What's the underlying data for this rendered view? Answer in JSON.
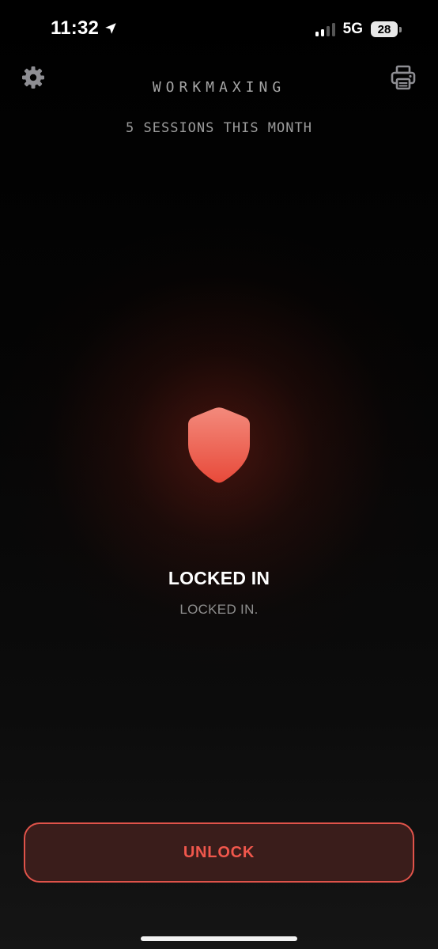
{
  "status_bar": {
    "time": "11:32",
    "network": "5G",
    "battery": "28",
    "icons": {
      "location": "location-arrow-icon",
      "signal": "cellular-signal-icon",
      "battery": "battery-icon"
    }
  },
  "header": {
    "title": "WORKMAXING",
    "sessions_text": "5 SESSIONS THIS MONTH",
    "settings_icon": "gear-icon",
    "print_icon": "printer-icon"
  },
  "main": {
    "shield_icon": "shield-icon",
    "status_title": "LOCKED IN",
    "status_subtitle": "LOCKED IN."
  },
  "actions": {
    "unlock_label": "UNLOCK"
  },
  "colors": {
    "accent": "#f0574c",
    "button_background": "#3a1d1b",
    "background": "#000000",
    "shield_top": "#f38a7c",
    "shield_bottom": "#e84a3a"
  }
}
